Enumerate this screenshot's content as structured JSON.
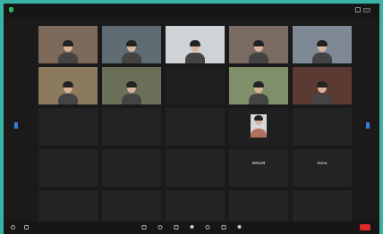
{
  "topbar": {
    "left_text": "",
    "title": "",
    "right_text": ""
  },
  "participants": [
    {
      "name": "",
      "sub": "",
      "type": "video",
      "color": "bg1"
    },
    {
      "name": "",
      "sub": "",
      "type": "video",
      "color": "bg2"
    },
    {
      "name": "",
      "sub": "",
      "type": "video",
      "color": "bg3"
    },
    {
      "name": "",
      "sub": "",
      "type": "video",
      "color": "bg4"
    },
    {
      "name": "",
      "sub": "",
      "type": "video",
      "color": "bg5"
    },
    {
      "name": "",
      "sub": "",
      "type": "video",
      "color": "bg6"
    },
    {
      "name": "",
      "sub": "",
      "type": "video",
      "color": "bg7"
    },
    {
      "name": "",
      "sub": "",
      "type": "blank",
      "color": ""
    },
    {
      "name": "",
      "sub": "",
      "type": "video",
      "color": "bg9"
    },
    {
      "name": "",
      "sub": "",
      "type": "video",
      "color": "bg10"
    },
    {
      "name": "",
      "sub": "",
      "type": "name",
      "color": ""
    },
    {
      "name": "",
      "sub": "",
      "type": "name",
      "color": ""
    },
    {
      "name": "",
      "sub": "",
      "type": "name",
      "color": ""
    },
    {
      "name": "",
      "sub": "",
      "type": "thumb",
      "color": ""
    },
    {
      "name": "",
      "sub": "",
      "type": "name",
      "color": ""
    },
    {
      "name": "",
      "sub": "",
      "type": "name",
      "color": ""
    },
    {
      "name": "",
      "sub": "",
      "type": "name",
      "color": ""
    },
    {
      "name": "",
      "sub": "",
      "type": "name",
      "color": ""
    },
    {
      "name": "MAGM",
      "sub": "",
      "type": "name",
      "color": ""
    },
    {
      "name": "Pone",
      "sub": "",
      "type": "name",
      "color": ""
    },
    {
      "name": "",
      "sub": "",
      "type": "name",
      "color": ""
    },
    {
      "name": "",
      "sub": "",
      "type": "name",
      "color": ""
    },
    {
      "name": "",
      "sub": "",
      "type": "name",
      "color": ""
    },
    {
      "name": "",
      "sub": "",
      "type": "name",
      "color": ""
    },
    {
      "name": "",
      "sub": "",
      "type": "name",
      "color": ""
    }
  ]
}
